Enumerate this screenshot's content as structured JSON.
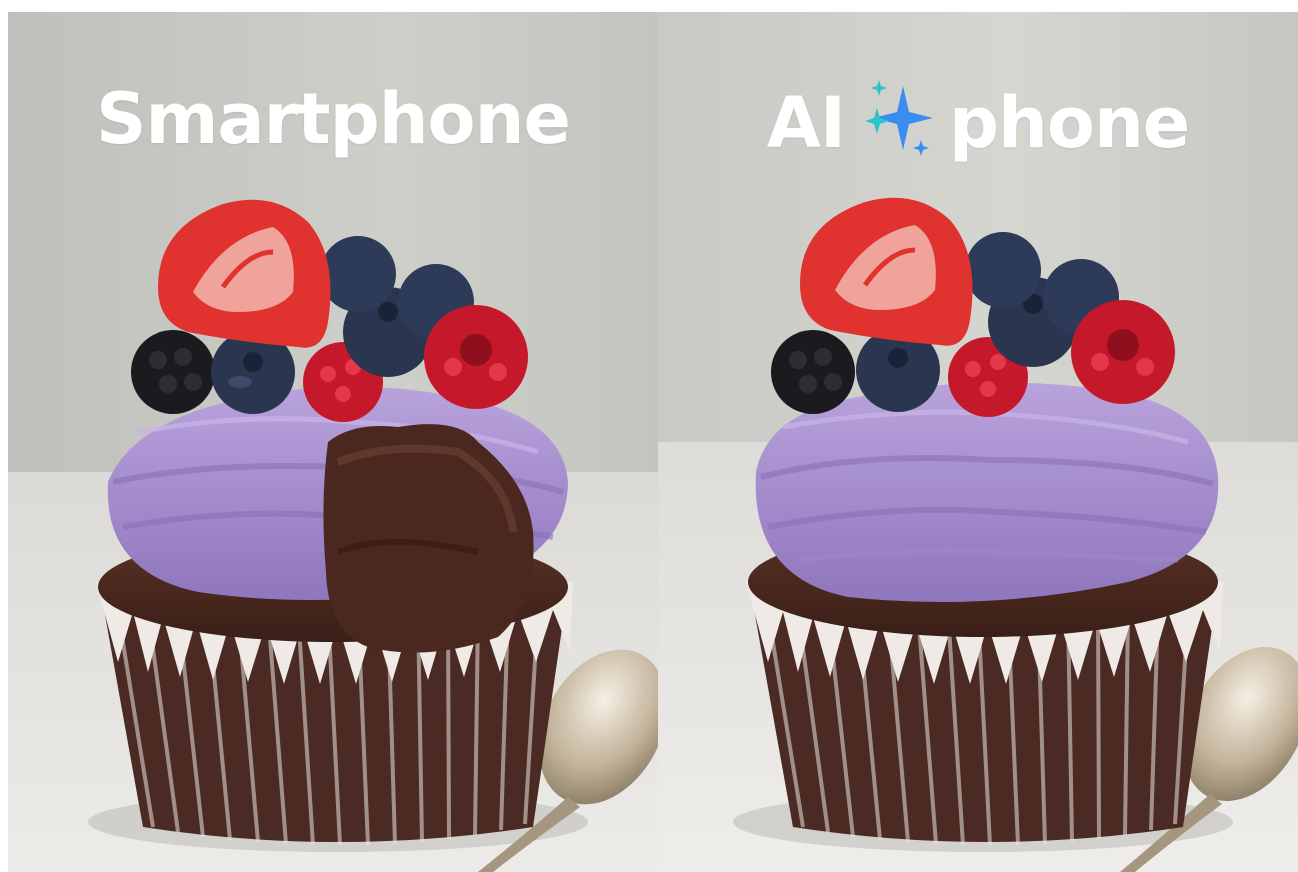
{
  "left_panel": {
    "headline": "Smartphone",
    "cupcake_state": "bitten"
  },
  "right_panel": {
    "headline_prefix": "AI",
    "headline_suffix": "phone",
    "cupcake_state": "whole",
    "icon": "ai-sparkle-icon"
  },
  "colors": {
    "background_wall": "#c9c9c4",
    "table_surface": "#e4e2df",
    "frosting": "#a38cc9",
    "cake": "#4a2a22",
    "liner": "#efeae6",
    "strawberry": "#e0322f",
    "raspberry": "#c5182b",
    "blueberry": "#2a3550",
    "blackberry": "#1a1a1f",
    "sparkle_blue": "#3a8df0",
    "sparkle_teal": "#2ec3c8"
  }
}
